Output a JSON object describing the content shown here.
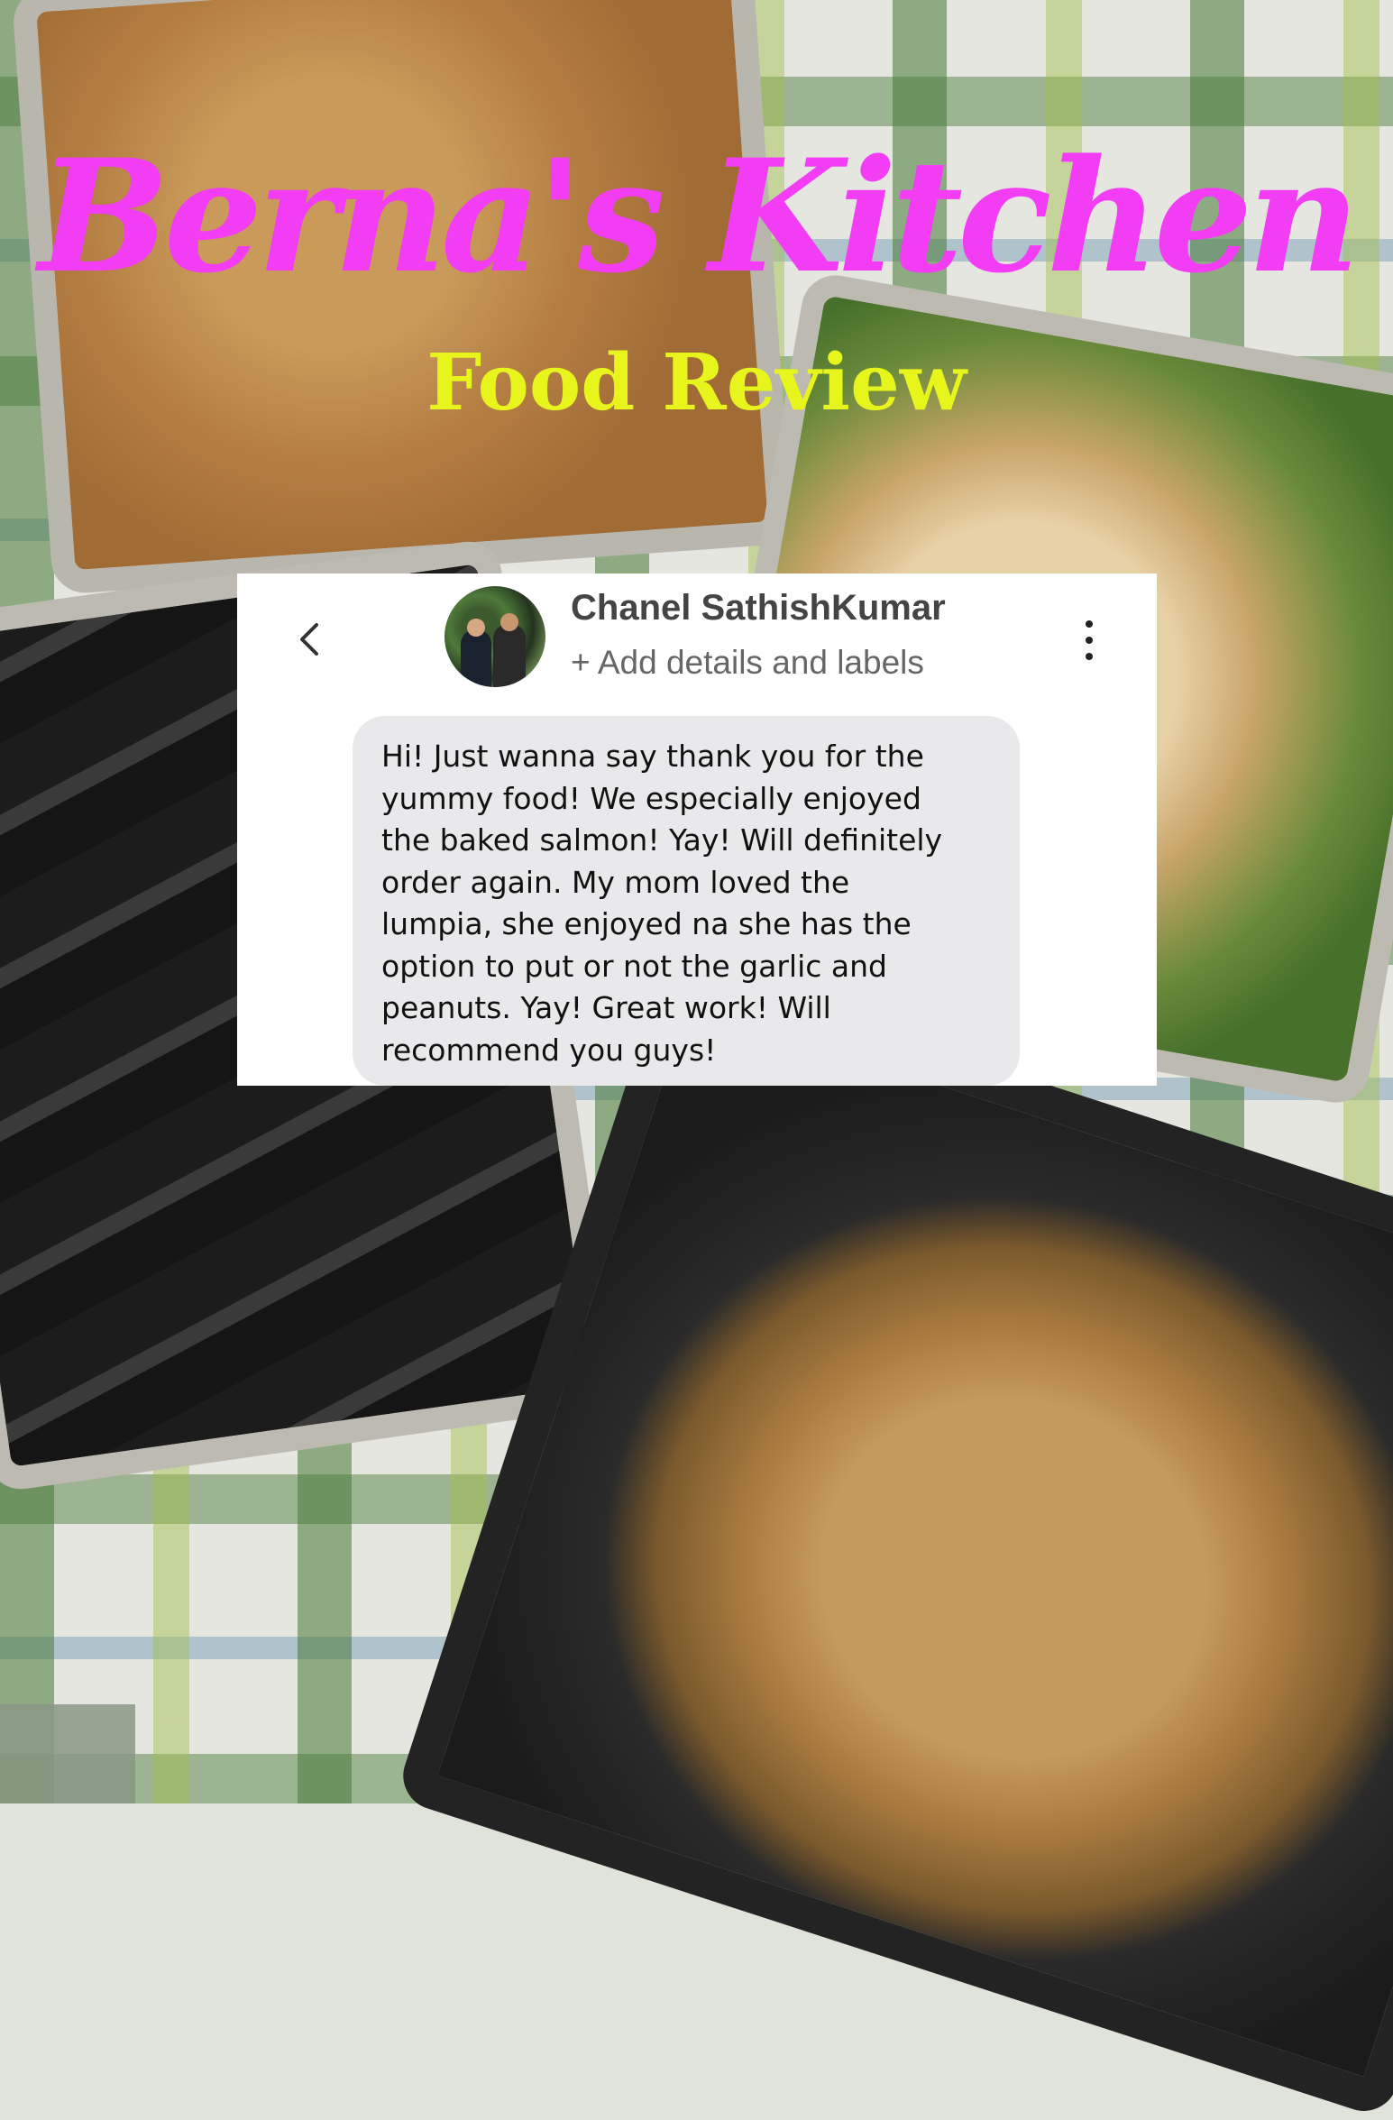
{
  "brand": {
    "title": "Berna's Kitchen",
    "subtitle": "Food Review",
    "title_color": "#f23df4",
    "subtitle_color": "#e8f51c"
  },
  "message_card": {
    "back_icon": "chevron-left-icon",
    "more_icon": "more-vertical-icon",
    "contact_name": "Chanel SathishKumar",
    "contact_subtitle": "+ Add details and labels",
    "message_lines": [
      "Hi! Just wanna say thank you for the",
      "yummy food! We especially enjoyed",
      "the baked salmon! Yay! Will definitely",
      "order again. My mom loved the",
      "lumpia, she enjoyed na she has the",
      "option to put or not the garlic and",
      "peanuts. Yay! Great work! Will",
      "recommend you guys!"
    ]
  }
}
